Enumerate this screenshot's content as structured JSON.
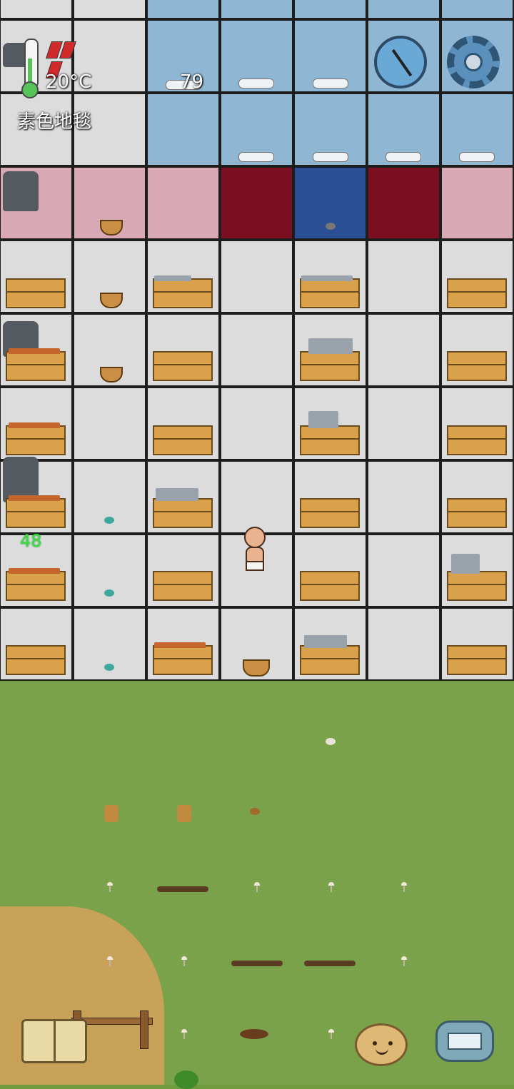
{
  "hud": {
    "temperature": "20°C",
    "tile_name": "素色地毯",
    "counter_top": "79",
    "counter_side": "48",
    "hunger_pips_filled": 3,
    "hunger_pips_total": 5
  },
  "colors": {
    "white_floor": "#dcdcdc",
    "blue_floor": "#8fb7d4",
    "pink_floor": "#d9a8b5",
    "red_floor": "#7a1022",
    "navy_floor": "#2a4f95",
    "grass": "#7aa24a",
    "temp_ok": "#56c25a"
  },
  "icons": {
    "thermometer": "thermometer-icon",
    "compass": "compass-icon",
    "settings": "gear-icon",
    "recipe_book": "book-icon",
    "emote": "potato-face-icon",
    "chat": "keyboard-icon"
  }
}
